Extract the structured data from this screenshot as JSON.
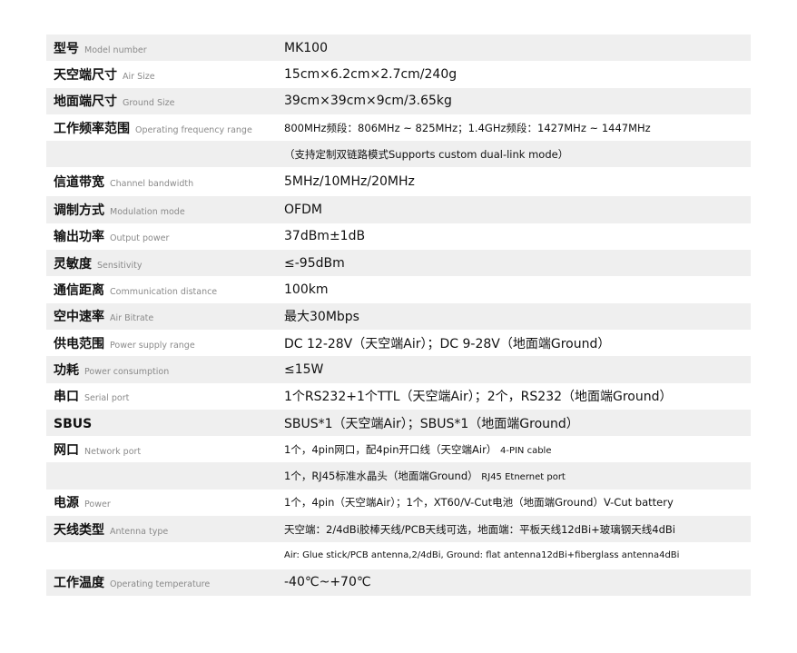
{
  "specs": [
    {
      "cn": "型号",
      "en": "Model number",
      "value": "MK100",
      "suffix": ""
    },
    {
      "cn": "天空端尺寸",
      "en": "Air Size",
      "value": "15cm×6.2cm×2.7cm/240g",
      "suffix": ""
    },
    {
      "cn": "地面端尺寸",
      "en": "Ground Size",
      "value": "39cm×39cm×9cm/3.65kg",
      "suffix": ""
    },
    {
      "cn": "工作频率范围",
      "en": "Operating frequency range",
      "value": "800MHz频段：806MHz ~ 825MHz；1.4GHz频段：1427MHz ~ 1447MHz",
      "suffix": ""
    },
    {
      "cn": "",
      "en": "",
      "value": "（支持定制双链路模式Supports custom dual-link mode）",
      "suffix": ""
    },
    {
      "cn": "信道带宽",
      "en": "Channel bandwidth",
      "value": "5MHz/10MHz/20MHz",
      "suffix": ""
    },
    {
      "cn": "调制方式",
      "en": "Modulation mode",
      "value": "OFDM",
      "suffix": ""
    },
    {
      "cn": "输出功率",
      "en": "Output power",
      "value": "37dBm±1dB",
      "suffix": ""
    },
    {
      "cn": "灵敏度",
      "en": "Sensitivity",
      "value": "≤-95dBm",
      "suffix": ""
    },
    {
      "cn": "通信距离",
      "en": "Communication distance",
      "value": "100km",
      "suffix": ""
    },
    {
      "cn": "空中速率",
      "en": "Air Bitrate",
      "value": "最大30Mbps",
      "suffix": ""
    },
    {
      "cn": "供电范围",
      "en": "Power supply range",
      "value": "DC 12-28V（天空端Air）；DC 9-28V（地面端Ground）",
      "suffix": ""
    },
    {
      "cn": "功耗",
      "en": "Power consumption",
      "value": "≤15W",
      "suffix": ""
    },
    {
      "cn": "串口",
      "en": "Serial port",
      "value": "1个RS232+1个TTL（天空端Air）；2个，RS232（地面端Ground）",
      "suffix": ""
    },
    {
      "cn": "SBUS",
      "en": "",
      "value": "SBUS*1（天空端Air）；SBUS*1（地面端Ground）",
      "suffix": ""
    },
    {
      "cn": "网口",
      "en": "Network port",
      "value": "1个，4pin网口，配4pin开口线（天空端Air）",
      "suffix": "4-PIN cable"
    },
    {
      "cn": "",
      "en": "",
      "value": "1个，RJ45标准水晶头（地面端Ground）",
      "suffix": "RJ45 Etnernet port"
    },
    {
      "cn": "电源",
      "en": "Power",
      "value": "1个，4pin（天空端Air）；1个，XT60/V-Cut电池（地面端Ground）V-Cut battery",
      "suffix": ""
    },
    {
      "cn": "天线类型",
      "en": "Antenna type",
      "value": "天空端：2/4dBi胶棒天线/PCB天线可选，地面端：平板天线12dBi+玻璃钢天线4dBi",
      "suffix": ""
    },
    {
      "cn": "",
      "en": "",
      "value": "Air: Glue stick/PCB antenna,2/4dBi, Ground: flat antenna12dBi+fiberglass antenna4dBi",
      "suffix": ""
    },
    {
      "cn": "工作温度",
      "en": "Operating temperature",
      "value": "-40℃~+70℃",
      "suffix": ""
    }
  ]
}
